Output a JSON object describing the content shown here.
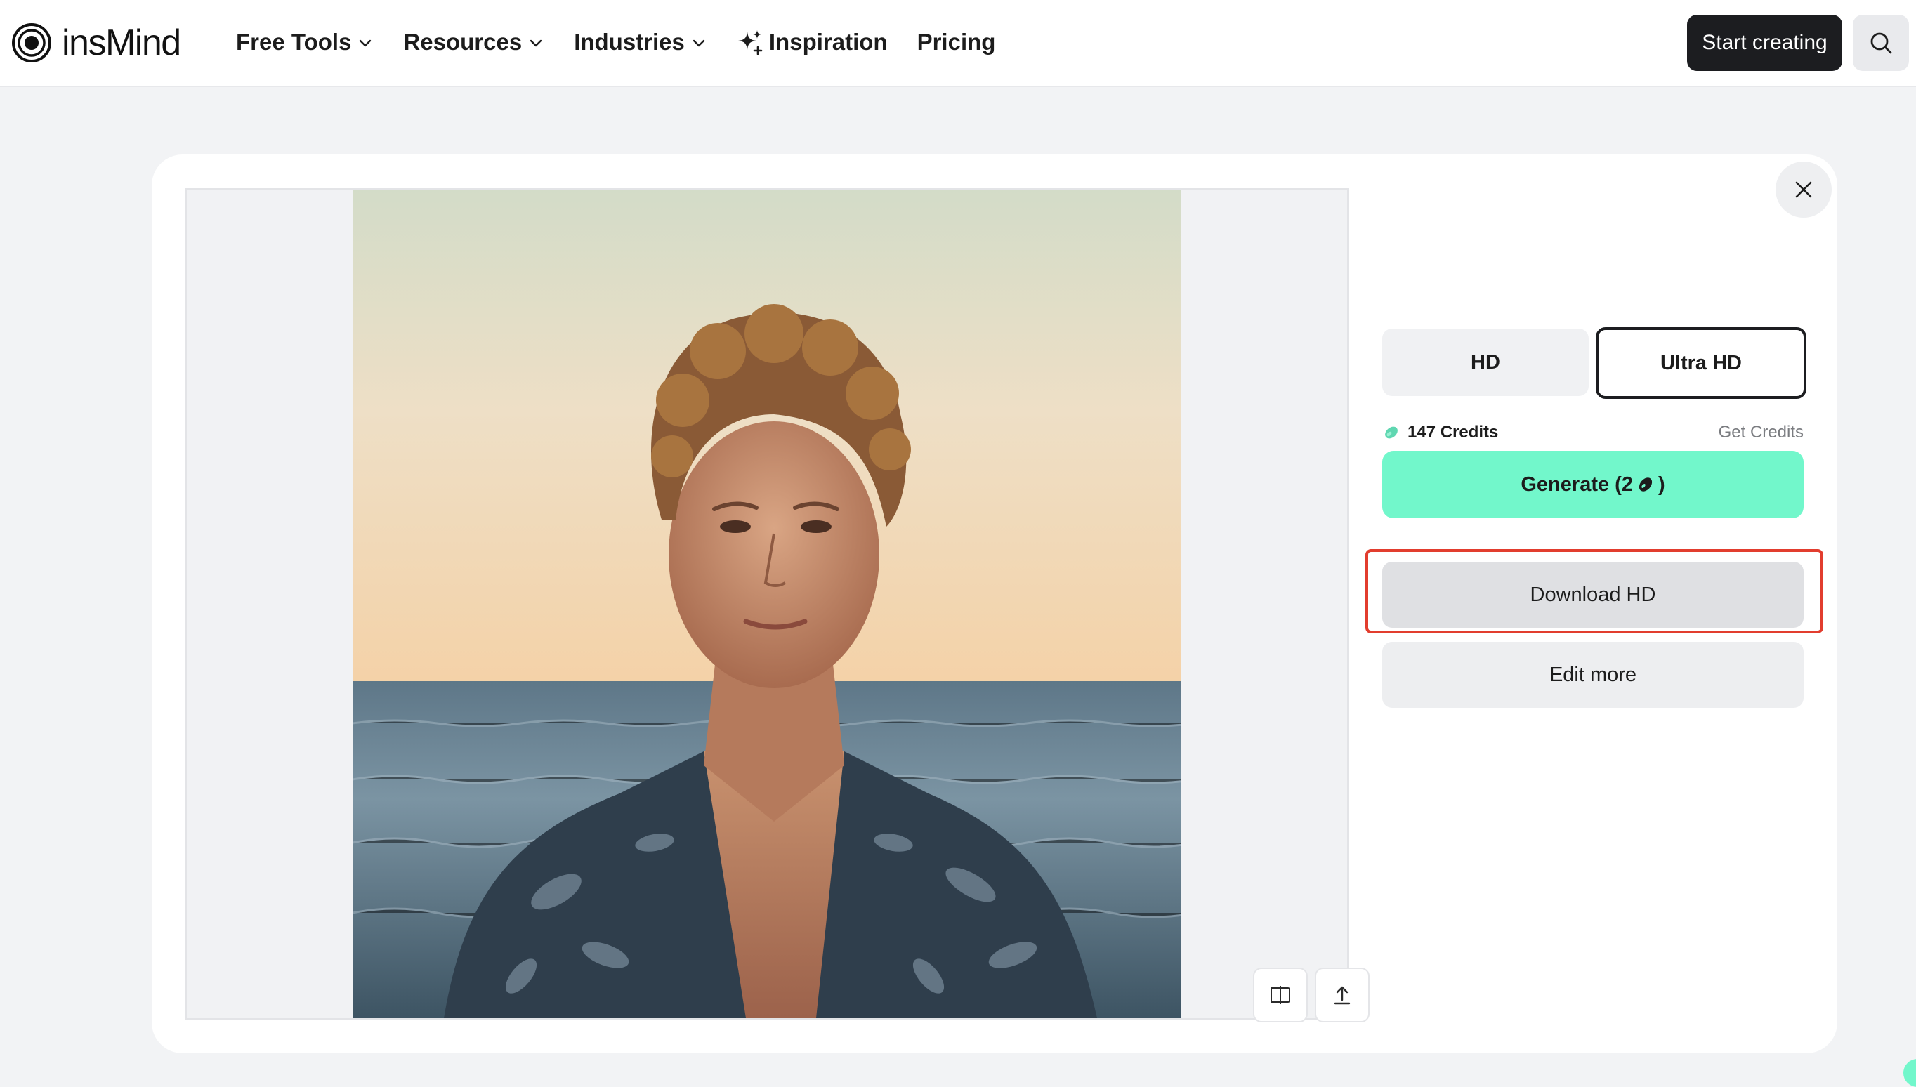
{
  "brand": {
    "name": "insMind",
    "icon": "concentric-rings-logo"
  },
  "nav": {
    "items": [
      {
        "label": "Free Tools",
        "has_dropdown": true
      },
      {
        "label": "Resources",
        "has_dropdown": true
      },
      {
        "label": "Industries",
        "has_dropdown": true
      },
      {
        "label": "Inspiration",
        "icon": "sparkle-icon"
      },
      {
        "label": "Pricing"
      }
    ],
    "cta": "Start creating",
    "search_icon": "search-icon"
  },
  "modal": {
    "image_alt": "Young man with curly hair in a patterned open shirt standing in front of the sea at sunset",
    "tools": {
      "compare_icon": "compare-icon",
      "share_icon": "share-icon"
    },
    "close_icon": "close-icon",
    "quality_options": [
      {
        "label": "HD",
        "selected": false
      },
      {
        "label": "Ultra HD",
        "selected": true
      }
    ],
    "credits": {
      "label": "147 Credits",
      "icon": "credit-bean-icon",
      "get_label": "Get Credits"
    },
    "generate": {
      "prefix": "Generate (2",
      "suffix": ")"
    },
    "download_label": "Download HD",
    "edit_label": "Edit more"
  },
  "colors": {
    "accent": "#72f7cb",
    "highlight": "#e23d2e",
    "dark_button": "#1c1d20",
    "background": "#f2f3f5"
  }
}
